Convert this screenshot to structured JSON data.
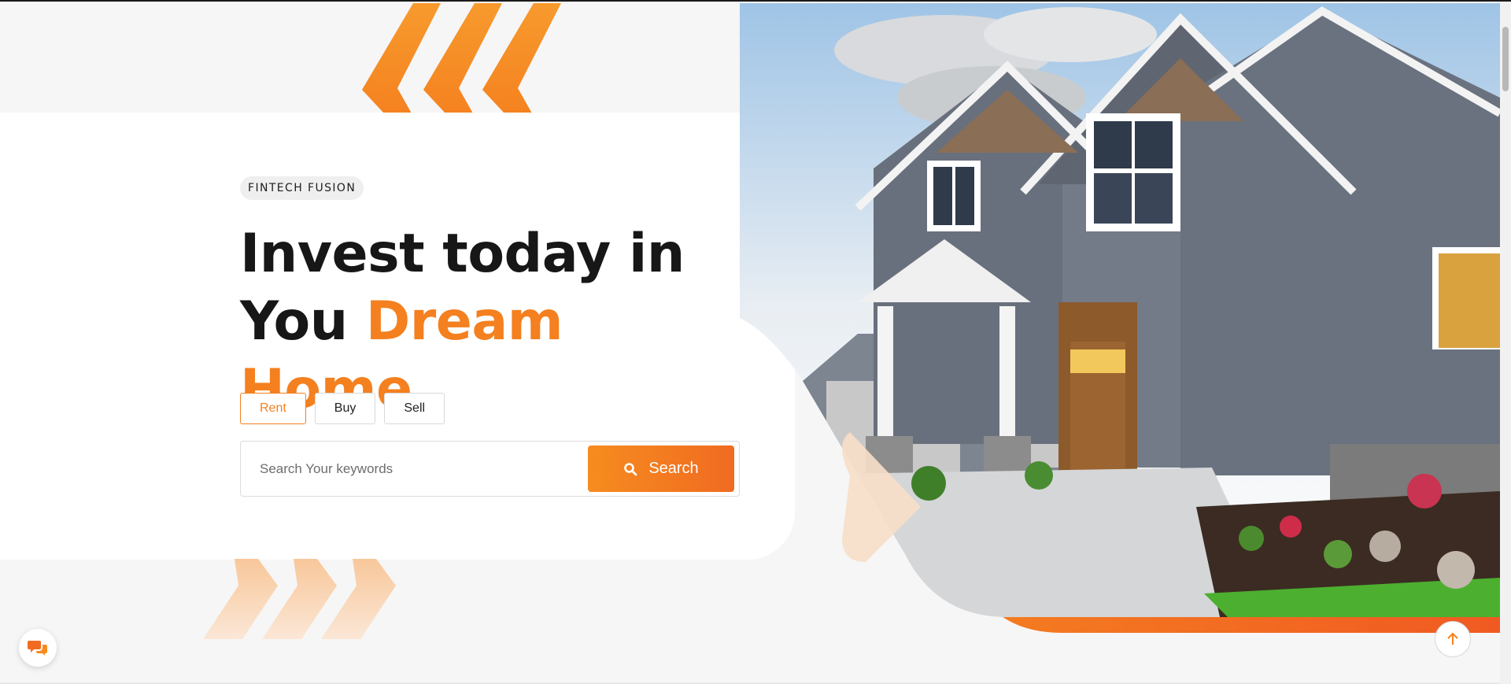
{
  "hero": {
    "badge": "FINTECH FUSION",
    "headline_line1": "Invest today in",
    "headline_line2_plain": "You ",
    "headline_line2_accent": "Dream Home"
  },
  "tabs": [
    {
      "label": "Rent",
      "active": true
    },
    {
      "label": "Buy",
      "active": false
    },
    {
      "label": "Sell",
      "active": false
    }
  ],
  "search": {
    "placeholder": "Search Your keywords",
    "button_label": "Search"
  },
  "colors": {
    "accent": "#f4801f",
    "accent_dark": "#f06b21",
    "heading": "#171717",
    "background": "#f6f6f6"
  },
  "icons": {
    "search": "search-icon",
    "chat": "chat-icon",
    "scroll_top": "arrow-up-icon"
  }
}
